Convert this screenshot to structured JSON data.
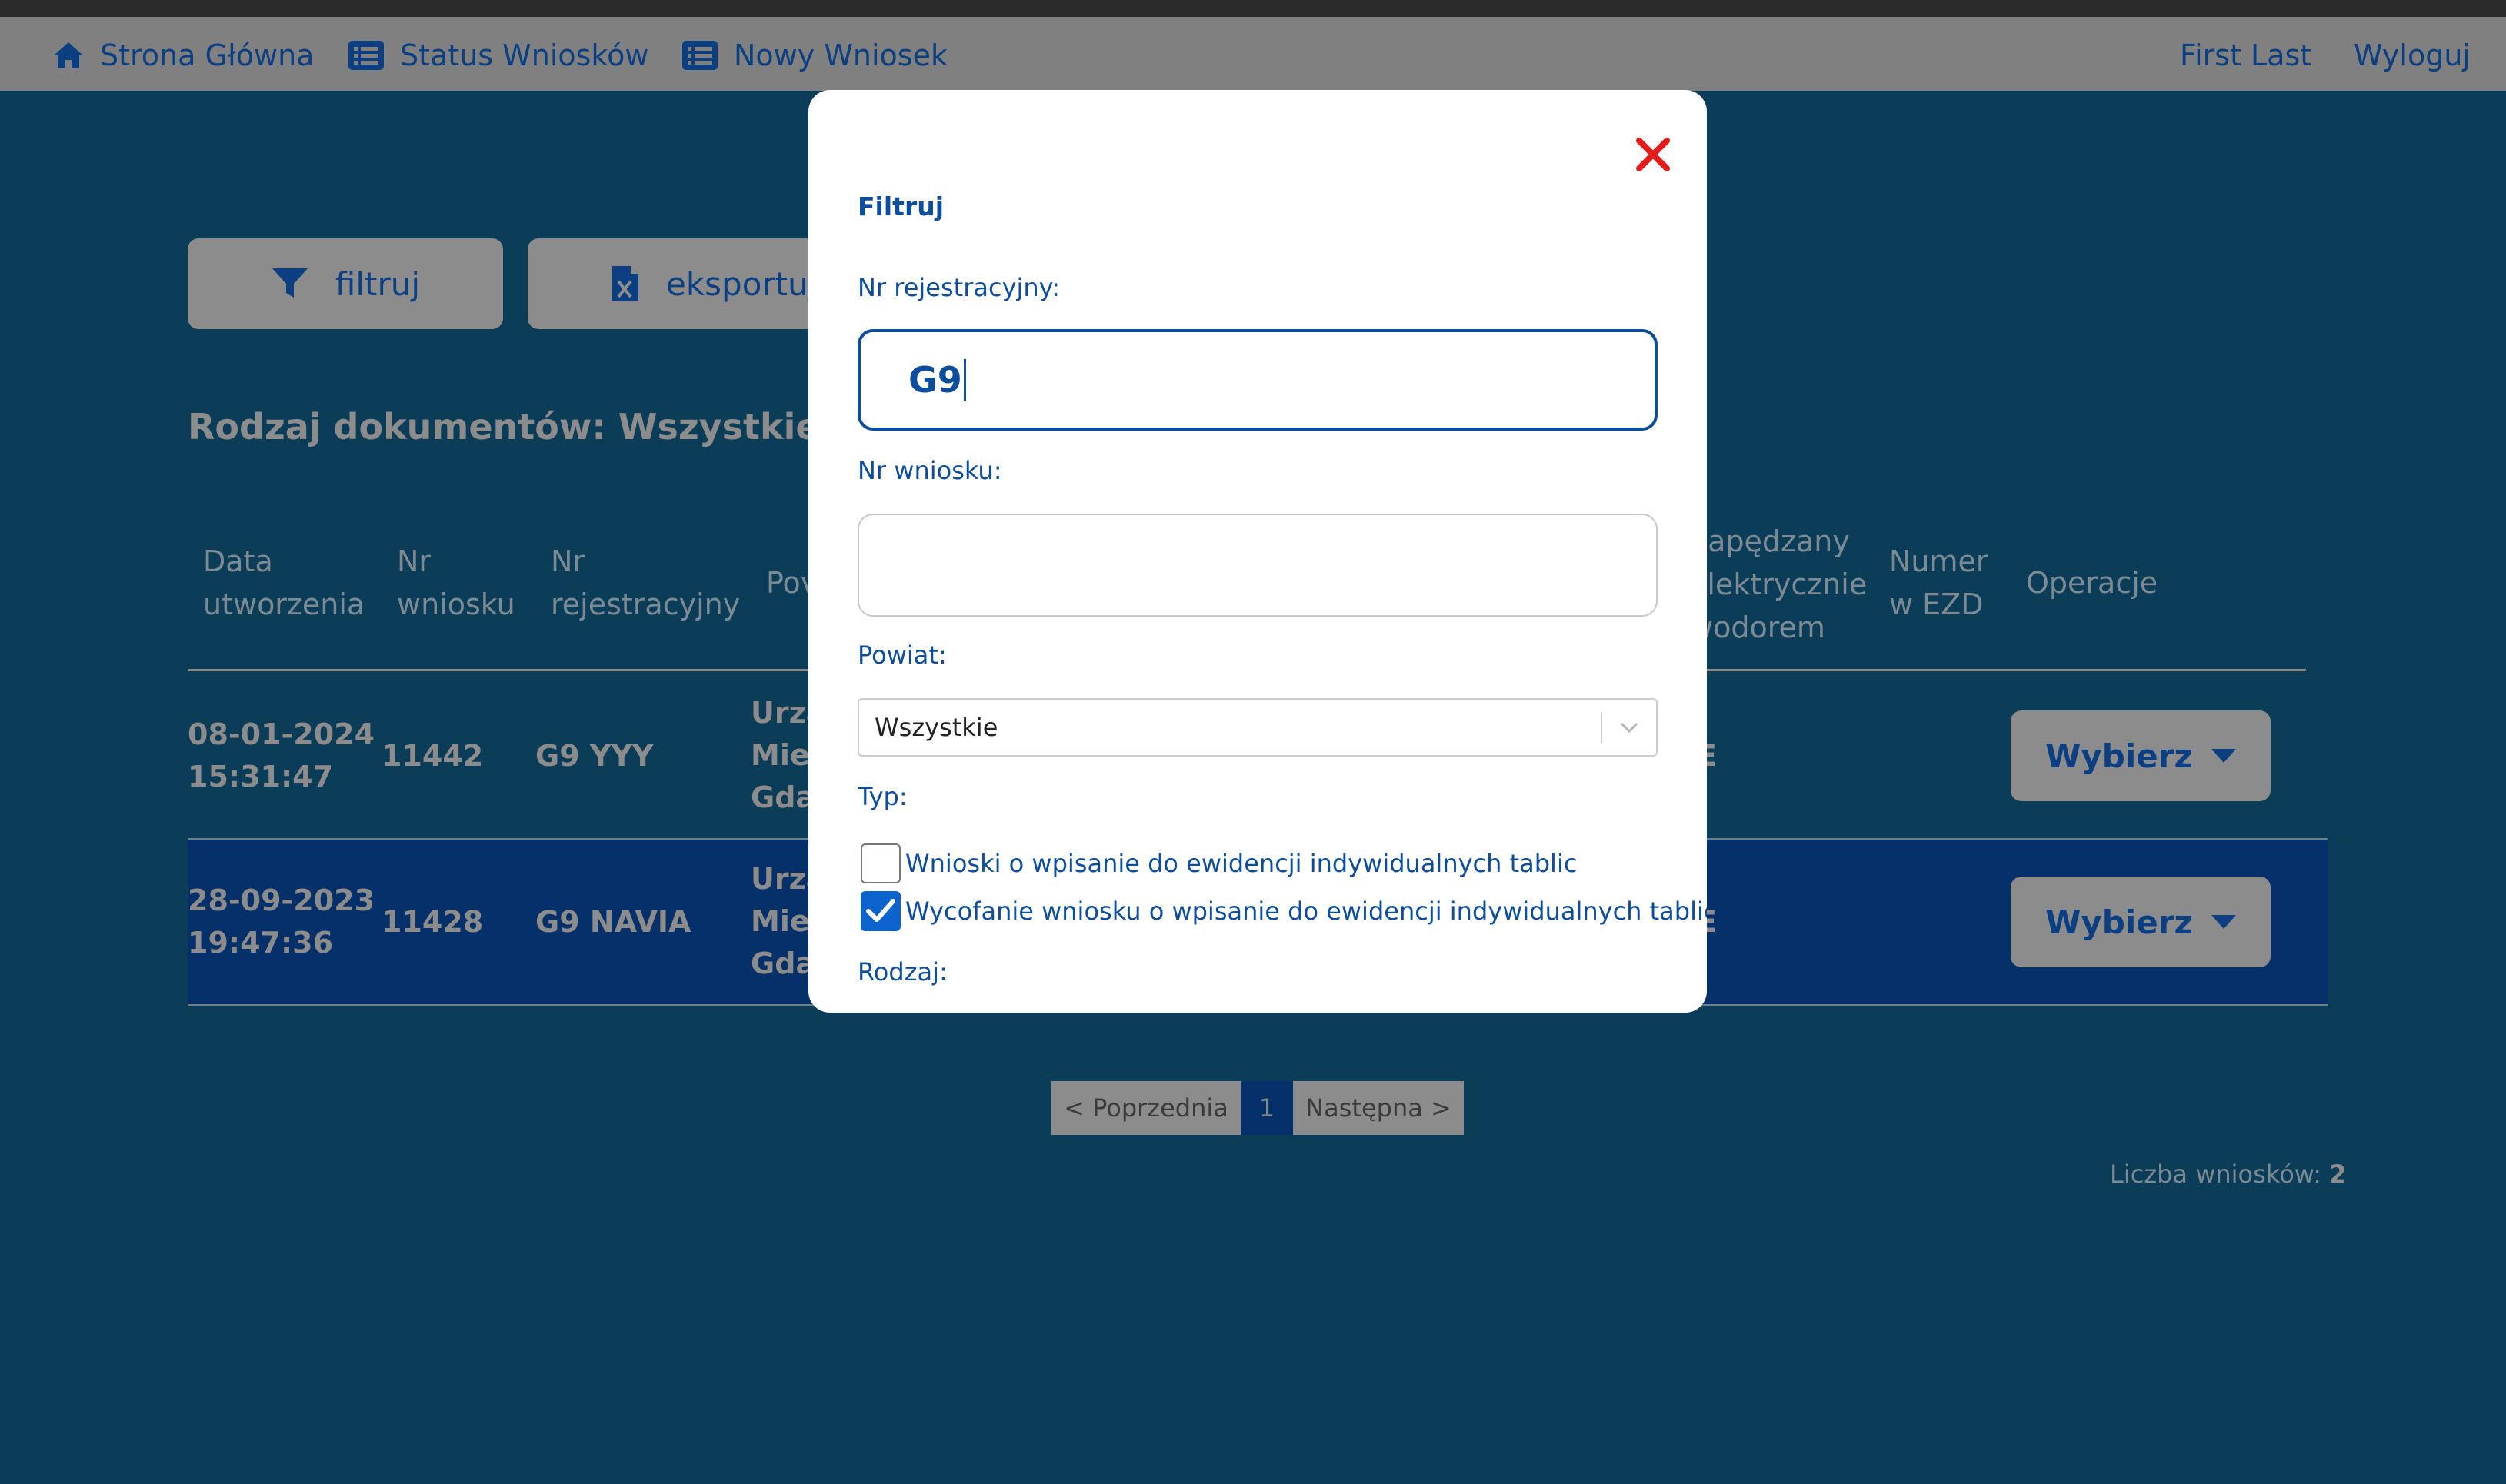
{
  "nav": {
    "home": "Strona Główna",
    "status": "Status Wniosków",
    "new": "Nowy Wniosek",
    "user": "First Last",
    "logout": "Wyloguj"
  },
  "actions": {
    "filter": "filtruj",
    "export": "eksportuj"
  },
  "doc_type_heading": "Rodzaj dokumentów: Wszystkie",
  "table": {
    "headers": {
      "date": [
        "Data",
        "utworzenia"
      ],
      "nr": [
        "Nr",
        "wniosku"
      ],
      "reg": [
        "Nr",
        "rejestracyjny"
      ],
      "powiat": "Pov",
      "electric": [
        "napędzany",
        "elektrycznie",
        "wodorem"
      ],
      "ezd": [
        "Numer",
        "w EZD"
      ],
      "ops": "Operacje"
    },
    "rows": [
      {
        "date": "08-01-2024",
        "time": "15:31:47",
        "nr": "11442",
        "reg": "G9 YYY",
        "office": [
          "Urzą",
          "Mie",
          "Gda"
        ],
        "electric": "E",
        "action": "Wybierz"
      },
      {
        "date": "28-09-2023",
        "time": "19:47:36",
        "nr": "11428",
        "reg": "G9 NAVIA",
        "office": [
          "Urzą",
          "Mie",
          "Gda"
        ],
        "electric": "E",
        "action": "Wybierz"
      }
    ]
  },
  "pagination": {
    "prev": "< Poprzednia",
    "current": "1",
    "next": "Następna >"
  },
  "count": {
    "label": "Liczba wniosków:",
    "value": "2"
  },
  "modal": {
    "title": "Filtruj",
    "reg_label": "Nr rejestracyjny:",
    "reg_value": "G9",
    "nr_label": "Nr wniosku:",
    "nr_value": "",
    "powiat_label": "Powiat:",
    "powiat_value": "Wszystkie",
    "type_label": "Typ:",
    "type_options": [
      {
        "label": "Wnioski o wpisanie do ewidencji indywidualnych tablic",
        "checked": false
      },
      {
        "label": "Wycofanie wniosku o wpisanie do ewidencji indywidualnych tablic",
        "checked": true
      }
    ],
    "kind_label": "Rodzaj:"
  },
  "colors": {
    "brand_blue": "#0c4d9e",
    "close_red": "#e31c1c",
    "page_bg": "#0b3d59",
    "selected_row": "#06306a"
  }
}
